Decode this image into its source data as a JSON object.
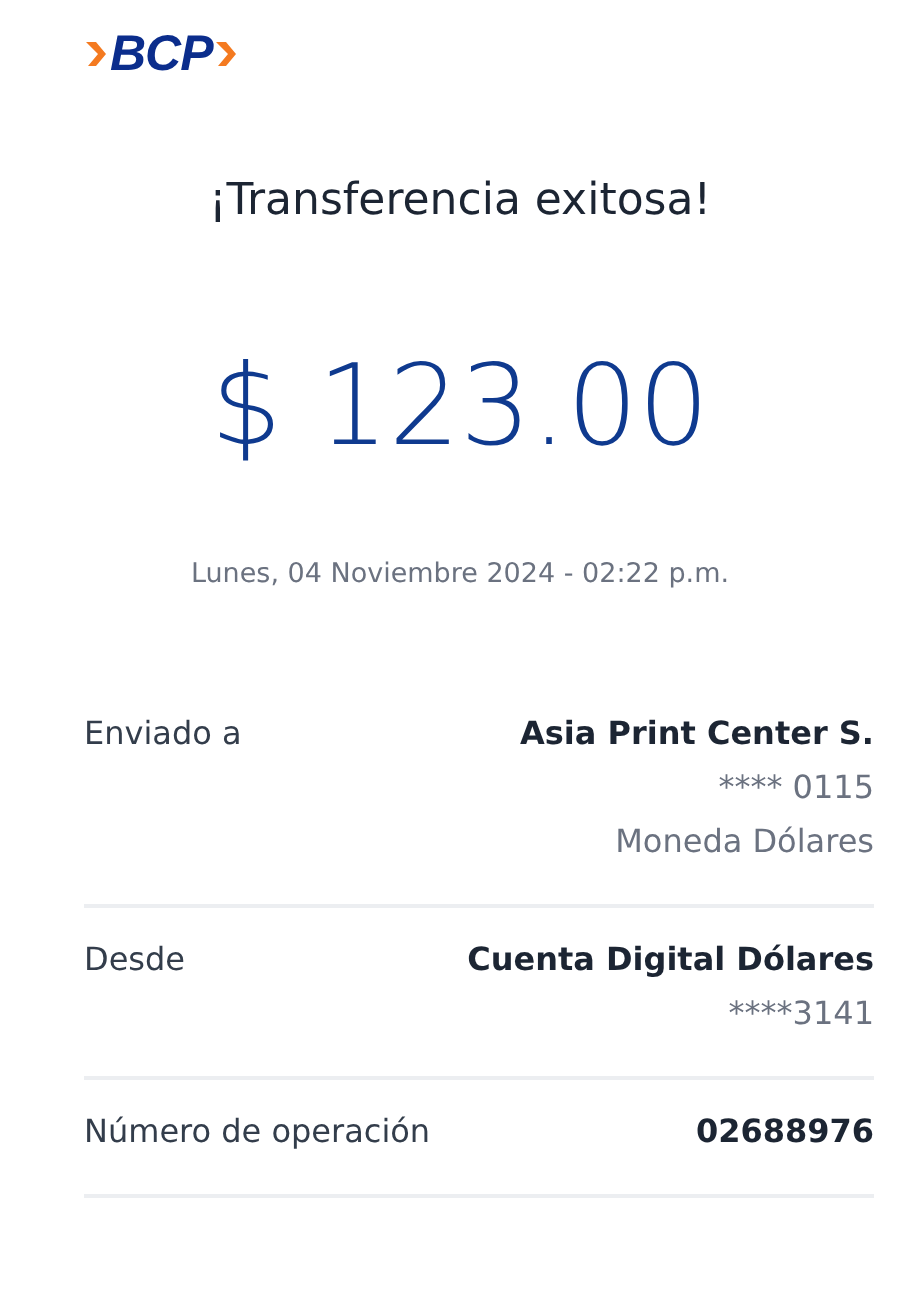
{
  "logo": {
    "text": "BCP"
  },
  "title": "¡Transferencia exitosa!",
  "amount": "$ 123.00",
  "date": "Lunes, 04 Noviembre 2024 - 02:22 p.m.",
  "details": [
    {
      "label": "Enviado a",
      "lines": [
        {
          "text": "Asia Print Center S.",
          "kind": "strong"
        },
        {
          "text": "**** 0115",
          "kind": "muted"
        },
        {
          "text": "Moneda Dólares",
          "kind": "muted"
        }
      ]
    },
    {
      "label": "Desde",
      "lines": [
        {
          "text": "Cuenta Digital Dólares",
          "kind": "strong"
        },
        {
          "text": "****3141",
          "kind": "muted"
        }
      ]
    },
    {
      "label": "Número de operación",
      "lines": [
        {
          "text": "02688976",
          "kind": "strong"
        }
      ]
    }
  ]
}
